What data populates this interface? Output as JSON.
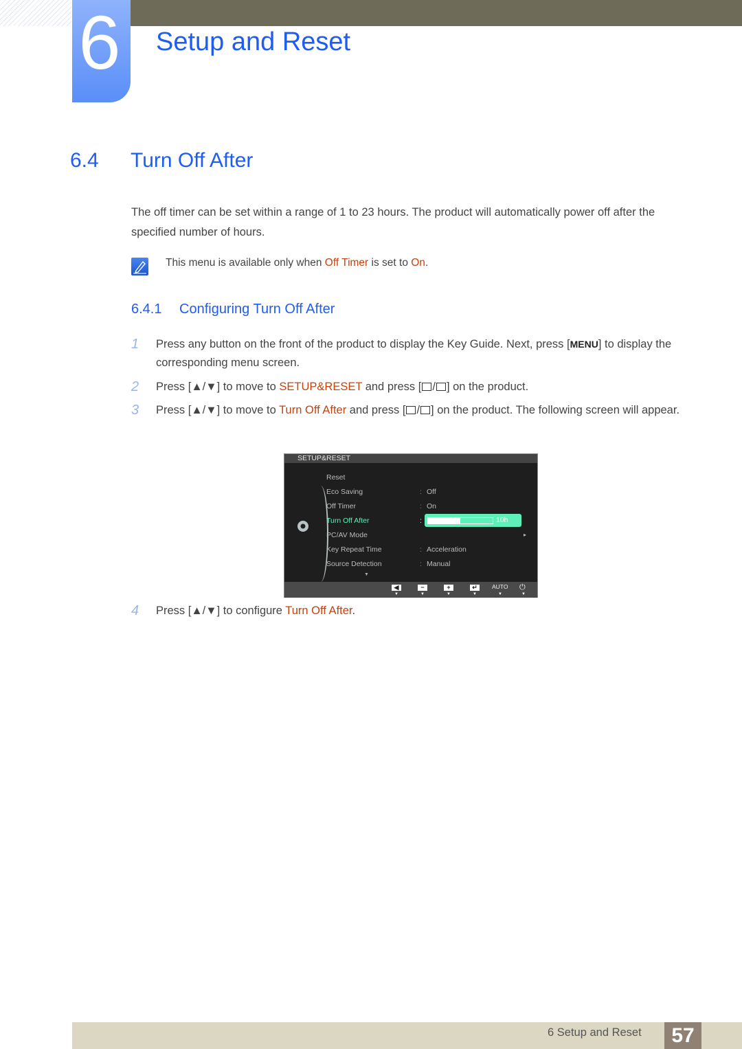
{
  "header": {
    "chapter_number": "6",
    "chapter_title": "Setup and Reset"
  },
  "section": {
    "number": "6.4",
    "title": "Turn Off After"
  },
  "intro": "The off timer can be set within a range of 1 to 23 hours. The product will automatically power off after the specified number of hours.",
  "note": {
    "icon": "note-pencil-icon",
    "prefix": "This menu is available only when ",
    "hl1": "Off Timer",
    "mid": " is set to ",
    "hl2": "On",
    "suffix": "."
  },
  "subsection": {
    "number": "6.4.1",
    "title": "Configuring Turn Off After"
  },
  "steps": [
    {
      "n": "1",
      "a": "Press any button on the front of the product to display the Key Guide. Next, press [",
      "key": "MENU",
      "b": "] to display the corresponding menu screen."
    },
    {
      "n": "2",
      "a": "Press [▲/▼] to move to ",
      "hl": "SETUP&RESET",
      "b": " and press [",
      "c": "] on the product."
    },
    {
      "n": "3",
      "a": "Press [▲/▼] to move to ",
      "hl": "Turn Off After",
      "b": " and press [",
      "c": "] on the product. The following screen will appear."
    },
    {
      "n": "4",
      "a": "Press [▲/▼] to configure ",
      "hl": "Turn Off After",
      "b": "."
    }
  ],
  "osd": {
    "title": "SETUP&RESET",
    "rows": [
      {
        "label": "Reset",
        "value": ""
      },
      {
        "label": "Eco Saving",
        "value": "Off"
      },
      {
        "label": "Off Timer",
        "value": "On"
      },
      {
        "label": "Turn Off After",
        "value": "10h",
        "progress": 0.5
      },
      {
        "label": "PC/AV Mode",
        "value": "▸"
      },
      {
        "label": "Key Repeat Time",
        "value": "Acceleration"
      },
      {
        "label": "Source Detection",
        "value": "Manual"
      }
    ],
    "footer": {
      "auto": "AUTO"
    },
    "colors": {
      "selected": "#5ef0b8"
    }
  },
  "footer": {
    "text": "6 Setup and Reset",
    "page": "57"
  }
}
